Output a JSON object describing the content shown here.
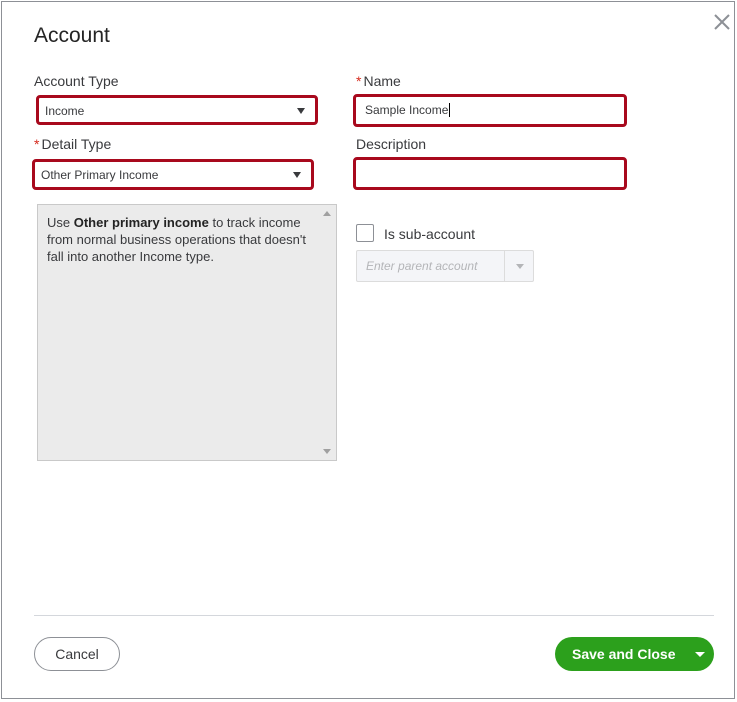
{
  "dialog": {
    "title": "Account",
    "close_icon": "close-icon"
  },
  "account_type": {
    "label": "Account Type",
    "value": "Income"
  },
  "name": {
    "required_mark": "*",
    "label": "Name",
    "value": "Sample Income"
  },
  "detail_type": {
    "required_mark": "*",
    "label": "Detail Type",
    "value": "Other Primary Income"
  },
  "description": {
    "label": "Description",
    "value": ""
  },
  "info": {
    "prefix": "Use ",
    "bold": "Other primary income",
    "suffix": " to track income from normal business operations that doesn't fall into another Income type."
  },
  "sub_account": {
    "label": "Is sub-account",
    "checked": false,
    "parent_placeholder": "Enter parent account"
  },
  "footer": {
    "cancel_label": "Cancel",
    "save_label": "Save and Close"
  },
  "colors": {
    "highlight_border": "#a8091d",
    "primary_green": "#2ca01c",
    "required_red": "#d52b1e"
  }
}
